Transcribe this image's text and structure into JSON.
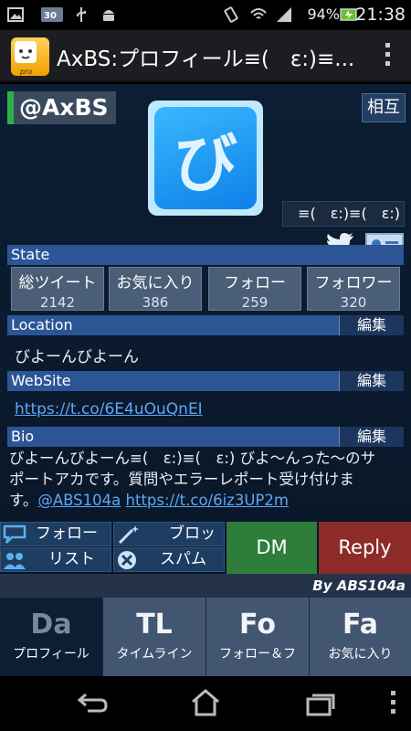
{
  "status_bar": {
    "battery": "94%",
    "time": "21:38",
    "notif_badge": "30"
  },
  "action_bar": {
    "app_icon_text": "Biyontter pro",
    "title": "AxBS:プロフィール≡(　ε:)≡..."
  },
  "profile": {
    "screen_name": "@AxBS",
    "relationship": "相互",
    "avatar_glyph": "び",
    "nickname": "≡(　ε:)≡(　ε:)"
  },
  "sections": {
    "state": "State",
    "location": "Location",
    "website": "WebSite",
    "bio": "Bio",
    "edit": "編集"
  },
  "stats": [
    {
      "label": "総ツイート",
      "value": "2142"
    },
    {
      "label": "お気に入り",
      "value": "386"
    },
    {
      "label": "フォロー",
      "value": "259"
    },
    {
      "label": "フォロワー",
      "value": "320"
    }
  ],
  "location_text": "びよーんびよーん",
  "website_url": "https://t.co/6E4uOuQnEI",
  "bio": {
    "line1": "びよーんびよーん≡(　ε:)≡(　ε:) びよ～んった～のサ",
    "line2": "ポートアカです。質問やエラーレポート受け付けま",
    "line3_prefix": "す。",
    "mention": "@ABS104a",
    "link": "https://t.co/6iz3UP2m"
  },
  "actions": {
    "follow": "フォロー",
    "block": "ブロック",
    "list": "リスト",
    "spam": "スパム",
    "dm": "DM",
    "reply": "Reply"
  },
  "byline": "By ABS104a",
  "tabs": [
    {
      "abbr": "Da",
      "label": "プロフィール",
      "active": true
    },
    {
      "abbr": "TL",
      "label": "タイムライン",
      "active": false
    },
    {
      "abbr": "Fo",
      "label": "フォロー＆フ",
      "active": false
    },
    {
      "abbr": "Fa",
      "label": "お気に入り",
      "active": false
    }
  ],
  "colors": {
    "accent_green": "#2bb24c",
    "section_blue": "#2c5596",
    "dm_green": "#2e7d3b",
    "reply_red": "#8c2b27",
    "battery_green": "#65c32b"
  }
}
